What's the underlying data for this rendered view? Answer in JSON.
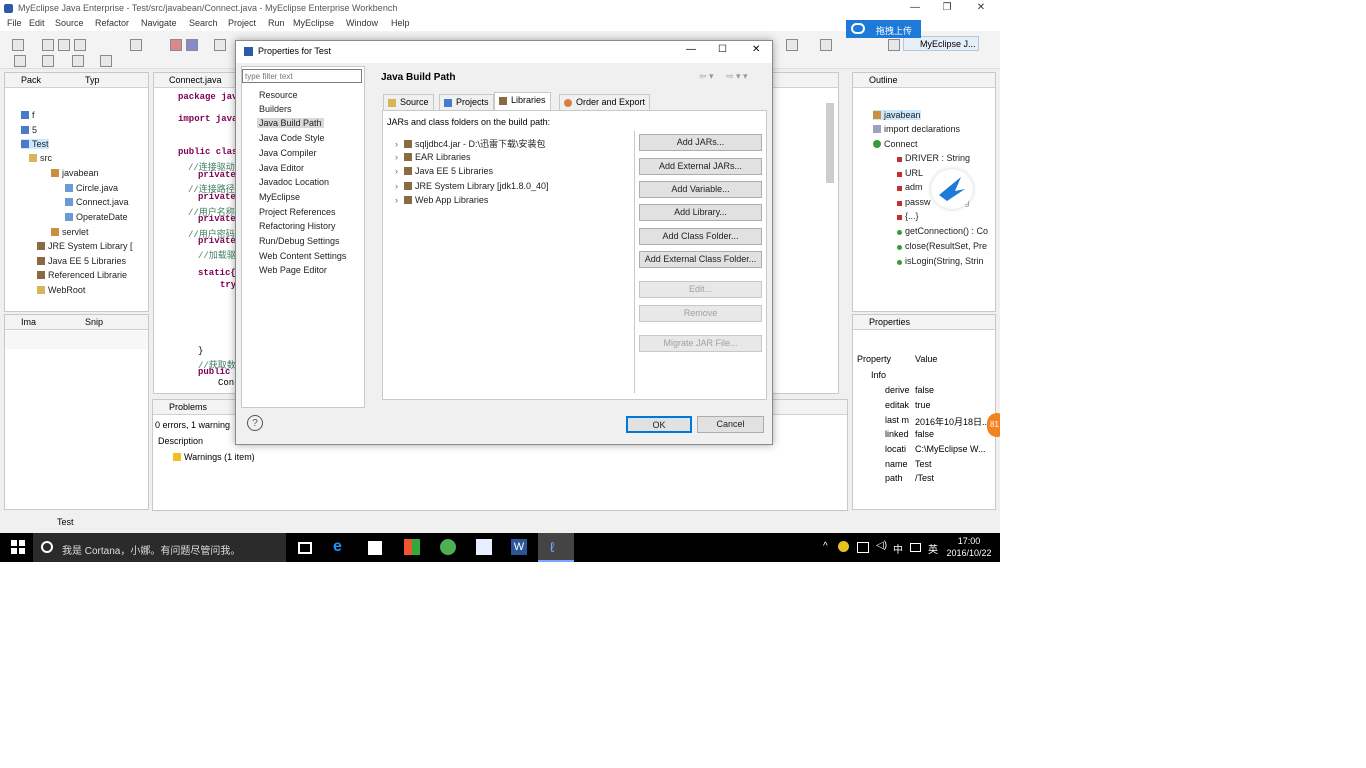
{
  "window": {
    "title": "MyEclipse Java Enterprise - Test/src/javabean/Connect.java - MyEclipse Enterprise Workbench",
    "min": "—",
    "restore": "❐",
    "close": "✕"
  },
  "menu": [
    "File",
    "Edit",
    "Source",
    "Refactor",
    "Navigate",
    "Search",
    "Project",
    "Run",
    "MyEclipse",
    "Window",
    "Help"
  ],
  "floating": {
    "upload_label": "拖拽上传",
    "perspective": "MyEclipse J..."
  },
  "package_explorer": {
    "tabs": [
      "Pack",
      "Typ"
    ],
    "items": [
      {
        "label": "f",
        "indent": 0
      },
      {
        "label": "5",
        "indent": 0
      },
      {
        "label": "Test",
        "indent": 0
      },
      {
        "label": "src",
        "indent": 1
      },
      {
        "label": "javabean",
        "indent": 2
      },
      {
        "label": "Circle.java",
        "indent": 3
      },
      {
        "label": "Connect.java",
        "indent": 3
      },
      {
        "label": "OperateDate",
        "indent": 3
      },
      {
        "label": "servlet",
        "indent": 2
      },
      {
        "label": "JRE System Library [",
        "indent": 1
      },
      {
        "label": "Java EE 5 Libraries",
        "indent": 1
      },
      {
        "label": "Referenced Librarie",
        "indent": 1
      },
      {
        "label": "WebRoot",
        "indent": 1
      }
    ]
  },
  "image_view": {
    "tabs": [
      "Ima",
      "Snip"
    ]
  },
  "editor": {
    "tab": "Connect.java",
    "lines": [
      {
        "text": "package java",
        "cls": "kw-line"
      },
      {
        "text": "import java",
        "cls": "kw-line"
      },
      {
        "text": "public class",
        "cls": "kw-line"
      },
      {
        "text": "//连接驱动",
        "cls": "cm"
      },
      {
        "text": "private",
        "cls": "kw"
      },
      {
        "text": "//连接路径",
        "cls": "cm"
      },
      {
        "text": "private",
        "cls": "kw"
      },
      {
        "text": "//用户名称",
        "cls": "cm"
      },
      {
        "text": "private",
        "cls": "kw"
      },
      {
        "text": "//用户密码",
        "cls": "cm"
      },
      {
        "text": "private",
        "cls": "kw"
      },
      {
        "text": "//加载驱动程序",
        "cls": "cm"
      },
      {
        "text": "static{",
        "cls": "kw"
      },
      {
        "text": "try",
        "cls": "kw"
      },
      {
        "text": "}",
        "cls": "plain"
      },
      {
        "text": "//获取数据库",
        "cls": "cm"
      },
      {
        "text": "public s",
        "cls": "kw"
      },
      {
        "text": "Conn",
        "cls": "plain"
      }
    ]
  },
  "problems": {
    "tab": "Problems",
    "summary": "0 errors, 1 warning",
    "column": "Description",
    "row": "Warnings (1 item)"
  },
  "status_bar": {
    "text": "Test"
  },
  "outline": {
    "tab": "Outline",
    "items": [
      {
        "label": "javabean",
        "indent": 0
      },
      {
        "label": "import declarations",
        "indent": 0
      },
      {
        "label": "Connect",
        "indent": 0
      },
      {
        "label": "DRIVER : String",
        "indent": 1
      },
      {
        "label": "URL",
        "indent": 1
      },
      {
        "label": "adm",
        "indent": 1
      },
      {
        "label": "passw",
        "indent": 1
      },
      {
        "label": "{...}",
        "indent": 1
      },
      {
        "label": "getConnection() : Co",
        "indent": 1
      },
      {
        "label": "close(ResultSet, Pre",
        "indent": 1
      },
      {
        "label": "isLogin(String, Strin",
        "indent": 1
      }
    ],
    "partial": "ring"
  },
  "properties_view": {
    "tab": "Properties",
    "col_property": "Property",
    "col_value": "Value",
    "section": "Info",
    "rows": [
      {
        "key": "derive",
        "value": "false"
      },
      {
        "key": "editak",
        "value": "true"
      },
      {
        "key": "last m",
        "value": "2016年10月18日..."
      },
      {
        "key": "linked",
        "value": "false"
      },
      {
        "key": "locati",
        "value": "C:\\MyEclipse W..."
      },
      {
        "key": "name",
        "value": "Test"
      },
      {
        "key": "path",
        "value": "/Test"
      }
    ],
    "badge": "81"
  },
  "dialog": {
    "title": "Properties for Test",
    "filter_placeholder": "type filter text",
    "nav": [
      "Resource",
      "Builders",
      "Java Build Path",
      "Java Code Style",
      "Java Compiler",
      "Java Editor",
      "Javadoc Location",
      "MyEclipse",
      "Project References",
      "Refactoring History",
      "Run/Debug Settings",
      "Web Content Settings",
      "Web Page Editor"
    ],
    "selected_nav": "Java Build Path",
    "page_title": "Java Build Path",
    "tabs": [
      "Source",
      "Projects",
      "Libraries",
      "Order and Export"
    ],
    "selected_tab": "Libraries",
    "description": "JARs and class folders on the build path:",
    "libraries": [
      "sqljdbc4.jar - D:\\迅雷下载\\安装包",
      "EAR Libraries",
      "Java EE 5 Libraries",
      "JRE System Library [jdk1.8.0_40]",
      "Web App Libraries"
    ],
    "buttons": [
      {
        "label": "Add JARs...",
        "enabled": true
      },
      {
        "label": "Add External JARs...",
        "enabled": true
      },
      {
        "label": "Add Variable...",
        "enabled": true
      },
      {
        "label": "Add Library...",
        "enabled": true
      },
      {
        "label": "Add Class Folder...",
        "enabled": true
      },
      {
        "label": "Add External Class Folder...",
        "enabled": true
      },
      {
        "label": "Edit...",
        "enabled": false
      },
      {
        "label": "Remove",
        "enabled": false
      },
      {
        "label": "Migrate JAR File...",
        "enabled": false
      }
    ],
    "help": "?",
    "ok": "OK",
    "cancel": "Cancel"
  },
  "taskbar": {
    "search_text": "我是 Cortana，小娜。有问题尽管问我。",
    "time": "17:00",
    "date": "2016/10/22",
    "ime": "英",
    "ime2": "中"
  },
  "colors": {
    "selection": "#cce8ff",
    "accent": "#0078d7",
    "taskbar": "#000000",
    "dialog_bg": "#f0f0f0",
    "badge": "#f58220"
  }
}
